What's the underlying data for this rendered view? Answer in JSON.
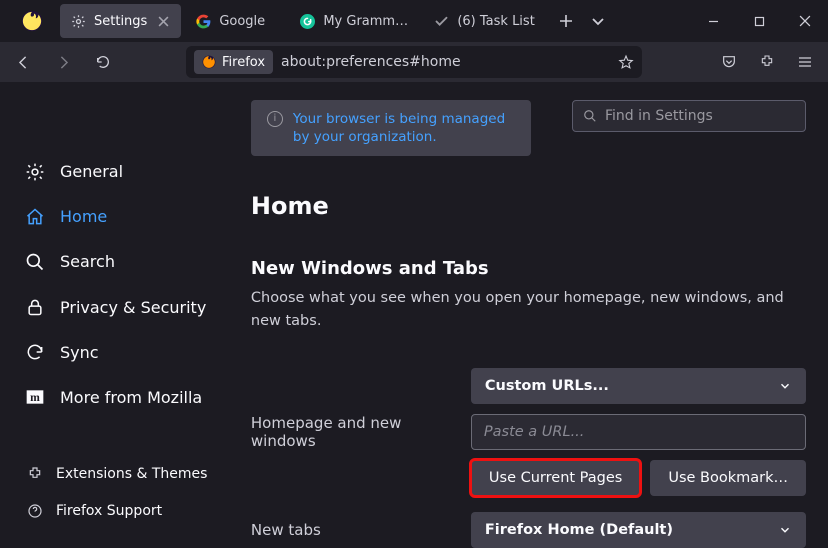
{
  "tabs": [
    {
      "label": "Settings"
    },
    {
      "label": "Google"
    },
    {
      "label": "My Grammarly"
    },
    {
      "label": "(6) Task List"
    }
  ],
  "url": {
    "identity_label": "Firefox",
    "address": "about:preferences#home"
  },
  "managed_notice": "Your browser is being managed by your organization.",
  "search_placeholder": "Find in Settings",
  "sidebar": {
    "general": "General",
    "home": "Home",
    "search": "Search",
    "privacy": "Privacy & Security",
    "sync": "Sync",
    "more": "More from Mozilla",
    "ext": "Extensions & Themes",
    "support": "Firefox Support"
  },
  "page": {
    "title": "Home",
    "section1": "New Windows and Tabs",
    "desc": "Choose what you see when you open your homepage, new windows, and new tabs.",
    "homepage_label": "Homepage and new windows",
    "homepage_select": "Custom URLs...",
    "url_placeholder": "Paste a URL...",
    "use_current": "Use Current Pages",
    "use_bookmark": "Use Bookmark…",
    "newtabs_label": "New tabs",
    "newtabs_select": "Firefox Home (Default)"
  }
}
